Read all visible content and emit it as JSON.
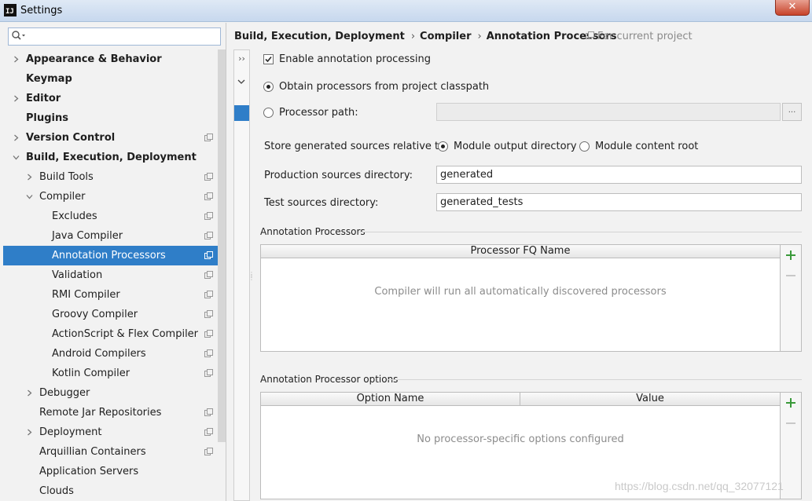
{
  "window": {
    "title": "Settings",
    "app_icon_text": "IJ",
    "close_glyph": "✕"
  },
  "search": {
    "placeholder": "",
    "value": "",
    "icon": "search-icon"
  },
  "tree": [
    {
      "label": "Appearance & Behavior",
      "level": 0,
      "bold": true,
      "arrow": "right",
      "proj": false,
      "selected": false
    },
    {
      "label": "Keymap",
      "level": 0,
      "bold": true,
      "arrow": "none",
      "proj": false,
      "selected": false
    },
    {
      "label": "Editor",
      "level": 0,
      "bold": true,
      "arrow": "right",
      "proj": false,
      "selected": false
    },
    {
      "label": "Plugins",
      "level": 0,
      "bold": true,
      "arrow": "none",
      "proj": false,
      "selected": false
    },
    {
      "label": "Version Control",
      "level": 0,
      "bold": true,
      "arrow": "right",
      "proj": true,
      "selected": false
    },
    {
      "label": "Build, Execution, Deployment",
      "level": 0,
      "bold": true,
      "arrow": "down",
      "proj": false,
      "selected": false
    },
    {
      "label": "Build Tools",
      "level": 1,
      "bold": false,
      "arrow": "right",
      "proj": true,
      "selected": false
    },
    {
      "label": "Compiler",
      "level": 1,
      "bold": false,
      "arrow": "down",
      "proj": true,
      "selected": false
    },
    {
      "label": "Excludes",
      "level": 2,
      "bold": false,
      "arrow": "none",
      "proj": true,
      "selected": false
    },
    {
      "label": "Java Compiler",
      "level": 2,
      "bold": false,
      "arrow": "none",
      "proj": true,
      "selected": false
    },
    {
      "label": "Annotation Processors",
      "level": 2,
      "bold": false,
      "arrow": "none",
      "proj": true,
      "selected": true
    },
    {
      "label": "Validation",
      "level": 2,
      "bold": false,
      "arrow": "none",
      "proj": true,
      "selected": false
    },
    {
      "label": "RMI Compiler",
      "level": 2,
      "bold": false,
      "arrow": "none",
      "proj": true,
      "selected": false
    },
    {
      "label": "Groovy Compiler",
      "level": 2,
      "bold": false,
      "arrow": "none",
      "proj": true,
      "selected": false
    },
    {
      "label": "ActionScript & Flex Compiler",
      "level": 2,
      "bold": false,
      "arrow": "none",
      "proj": true,
      "selected": false
    },
    {
      "label": "Android Compilers",
      "level": 2,
      "bold": false,
      "arrow": "none",
      "proj": true,
      "selected": false
    },
    {
      "label": "Kotlin Compiler",
      "level": 2,
      "bold": false,
      "arrow": "none",
      "proj": true,
      "selected": false
    },
    {
      "label": "Debugger",
      "level": 1,
      "bold": false,
      "arrow": "right",
      "proj": false,
      "selected": false
    },
    {
      "label": "Remote Jar Repositories",
      "level": 1,
      "bold": false,
      "arrow": "none",
      "proj": true,
      "selected": false
    },
    {
      "label": "Deployment",
      "level": 1,
      "bold": false,
      "arrow": "right",
      "proj": true,
      "selected": false
    },
    {
      "label": "Arquillian Containers",
      "level": 1,
      "bold": false,
      "arrow": "none",
      "proj": true,
      "selected": false
    },
    {
      "label": "Application Servers",
      "level": 1,
      "bold": false,
      "arrow": "none",
      "proj": false,
      "selected": false
    },
    {
      "label": "Clouds",
      "level": 1,
      "bold": false,
      "arrow": "none",
      "proj": false,
      "selected": false
    }
  ],
  "breadcrumb": {
    "parts": [
      "Build, Execution, Deployment",
      "Compiler",
      "Annotation Processors"
    ],
    "separator": "›",
    "scope": "For current project"
  },
  "strip": {
    "expand_glyph": "››"
  },
  "form": {
    "enable_label": "Enable annotation processing",
    "enable_checked": true,
    "obtain_label": "Obtain processors from project classpath",
    "obtain_selected": true,
    "path_label": "Processor path:",
    "path_selected": false,
    "path_value": "",
    "browse_label": "...",
    "store_label": "Store generated sources relative to:",
    "module_output_label": "Module output directory",
    "module_output_selected": true,
    "module_content_label": "Module content root",
    "module_content_selected": false,
    "prod_label": "Production sources directory:",
    "prod_value": "generated",
    "test_label": "Test sources directory:",
    "test_value": "generated_tests"
  },
  "processors_section": {
    "title": "Annotation Processors",
    "column": "Processor FQ Name",
    "empty": "Compiler will run all automatically discovered processors"
  },
  "options_section": {
    "title": "Annotation Processor options",
    "columns": [
      "Option Name",
      "Value"
    ],
    "empty": "No processor-specific options configured"
  },
  "watermark": "https://blog.csdn.net/qq_32077121",
  "colors": {
    "selection": "#2f7ec8",
    "plus": "#3a9a3a",
    "check": "#2b2b2b"
  }
}
